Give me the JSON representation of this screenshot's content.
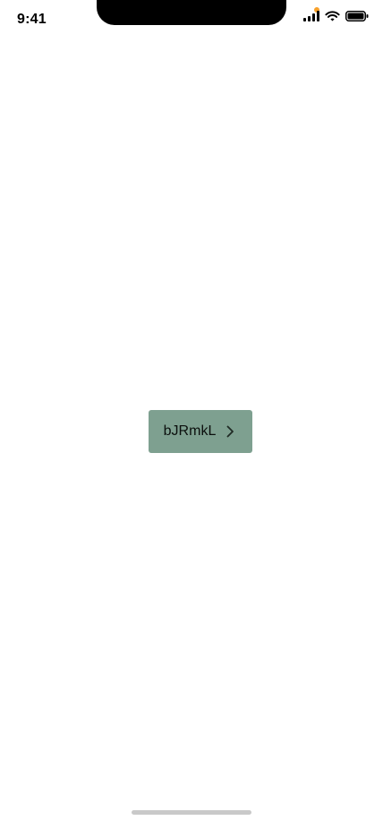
{
  "status_bar": {
    "time": "9:41",
    "icons": [
      "signal-icon",
      "wifi-icon",
      "battery-icon"
    ],
    "privacy_indicator_color": "#f7a02a"
  },
  "main": {
    "button": {
      "label": "bJRmkL",
      "icon": "chevron-right-icon",
      "background_color": "#7ea090"
    }
  },
  "colors": {
    "background": "#ffffff",
    "text": "#000000",
    "home_indicator": "#c9c9c9"
  }
}
